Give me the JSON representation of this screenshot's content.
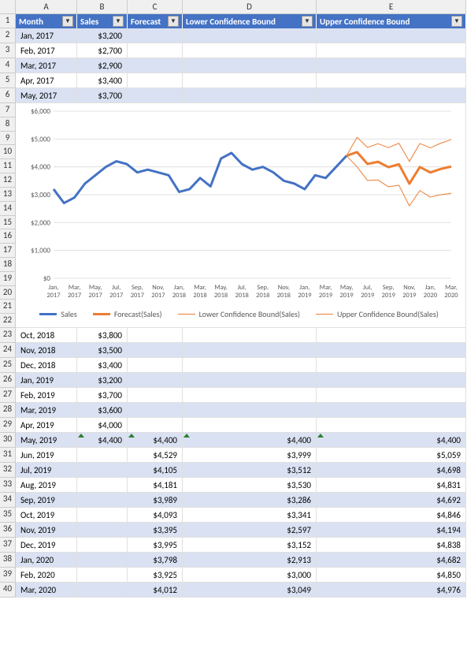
{
  "columns": [
    "A",
    "B",
    "C",
    "D",
    "E"
  ],
  "headers": {
    "month": "Month",
    "sales": "Sales",
    "forecast": "Forecast",
    "lower": "Lower Confidence Bound",
    "upper": "Upper Confidence Bound"
  },
  "rows_top": [
    {
      "n": 2,
      "month": "Jan, 2017",
      "sales": "$3,200"
    },
    {
      "n": 3,
      "month": "Feb, 2017",
      "sales": "$2,700"
    },
    {
      "n": 4,
      "month": "Mar, 2017",
      "sales": "$2,900"
    },
    {
      "n": 5,
      "month": "Apr, 2017",
      "sales": "$3,400"
    },
    {
      "n": 6,
      "month": "May, 2017",
      "sales": "$3,700"
    }
  ],
  "chart_rows": [
    7,
    8,
    9,
    10,
    11,
    12,
    13,
    14,
    15,
    16,
    17,
    18,
    19,
    20,
    21,
    22
  ],
  "rows_bottom": [
    {
      "n": 23,
      "month": "Oct, 2018",
      "sales": "$3,800"
    },
    {
      "n": 24,
      "month": "Nov, 2018",
      "sales": "$3,500"
    },
    {
      "n": 25,
      "month": "Dec, 2018",
      "sales": "$3,400"
    },
    {
      "n": 26,
      "month": "Jan, 2019",
      "sales": "$3,200"
    },
    {
      "n": 27,
      "month": "Feb, 2019",
      "sales": "$3,700"
    },
    {
      "n": 28,
      "month": "Mar, 2019",
      "sales": "$3,600"
    },
    {
      "n": 29,
      "month": "Apr, 2019",
      "sales": "$4,000"
    },
    {
      "n": 30,
      "month": "May, 2019",
      "sales": "$4,400",
      "forecast": "$4,400",
      "lower": "$4,400",
      "upper": "$4,400",
      "mark": true
    },
    {
      "n": 31,
      "month": "Jun, 2019",
      "forecast": "$4,529",
      "lower": "$3,999",
      "upper": "$5,059"
    },
    {
      "n": 32,
      "month": "Jul, 2019",
      "forecast": "$4,105",
      "lower": "$3,512",
      "upper": "$4,698"
    },
    {
      "n": 33,
      "month": "Aug, 2019",
      "forecast": "$4,181",
      "lower": "$3,530",
      "upper": "$4,831"
    },
    {
      "n": 34,
      "month": "Sep, 2019",
      "forecast": "$3,989",
      "lower": "$3,286",
      "upper": "$4,692"
    },
    {
      "n": 35,
      "month": "Oct, 2019",
      "forecast": "$4,093",
      "lower": "$3,341",
      "upper": "$4,846"
    },
    {
      "n": 36,
      "month": "Nov, 2019",
      "forecast": "$3,395",
      "lower": "$2,597",
      "upper": "$4,194"
    },
    {
      "n": 37,
      "month": "Dec, 2019",
      "forecast": "$3,995",
      "lower": "$3,152",
      "upper": "$4,838"
    },
    {
      "n": 38,
      "month": "Jan, 2020",
      "forecast": "$3,798",
      "lower": "$2,913",
      "upper": "$4,682"
    },
    {
      "n": 39,
      "month": "Feb, 2020",
      "forecast": "$3,925",
      "lower": "$3,000",
      "upper": "$4,850"
    },
    {
      "n": 40,
      "month": "Mar, 2020",
      "forecast": "$4,012",
      "lower": "$3,049",
      "upper": "$4,976"
    }
  ],
  "legend": {
    "sales": "Sales",
    "forecast": "Forecast(Sales)",
    "lower": "Lower Confidence Bound(Sales)",
    "upper": "Upper Confidence Bound(Sales)"
  },
  "chart_data": {
    "type": "line",
    "ylabel": "",
    "xlabel": "",
    "ylim": [
      0,
      6000
    ],
    "yticks": [
      "$0",
      "$1,000",
      "$2,000",
      "$3,000",
      "$4,000",
      "$5,000",
      "$6,000"
    ],
    "xticks_top": [
      "Jan,",
      "Mar,",
      "May,",
      "Jul,",
      "Sep,",
      "Nov,",
      "Jan,",
      "Mar,",
      "May,",
      "Jul,",
      "Sep,",
      "Nov,",
      "Jan,",
      "Mar,",
      "May,",
      "Jul,",
      "Sep,",
      "Nov,",
      "Jan,",
      "Mar,"
    ],
    "xticks_bottom": [
      "2017",
      "2017",
      "2017",
      "2017",
      "2017",
      "2017",
      "2018",
      "2018",
      "2018",
      "2018",
      "2018",
      "2018",
      "2019",
      "2019",
      "2019",
      "2019",
      "2019",
      "2019",
      "2020",
      "2020"
    ],
    "series": [
      {
        "name": "Sales",
        "color": "#4472C4",
        "width": 3,
        "values": [
          3200,
          2700,
          2900,
          3400,
          3700,
          4000,
          4200,
          4100,
          3800,
          3900,
          3800,
          3700,
          3100,
          3200,
          3600,
          3300,
          4300,
          4500,
          4100,
          3900,
          4000,
          3800,
          3500,
          3400,
          3200,
          3700,
          3600,
          4000,
          4400
        ]
      },
      {
        "name": "Forecast(Sales)",
        "color": "#ED7D31",
        "width": 3,
        "start": 28,
        "values": [
          4400,
          4529,
          4105,
          4181,
          3989,
          4093,
          3395,
          3995,
          3798,
          3925,
          4012
        ]
      },
      {
        "name": "Lower Confidence Bound(Sales)",
        "color": "#ED7D31",
        "width": 1,
        "start": 28,
        "values": [
          4400,
          3999,
          3512,
          3530,
          3286,
          3341,
          2597,
          3152,
          2913,
          3000,
          3049
        ]
      },
      {
        "name": "Upper Confidence Bound(Sales)",
        "color": "#ED7D31",
        "width": 1,
        "start": 28,
        "values": [
          4400,
          5059,
          4698,
          4831,
          4692,
          4846,
          4194,
          4838,
          4682,
          4850,
          4976
        ]
      }
    ]
  }
}
